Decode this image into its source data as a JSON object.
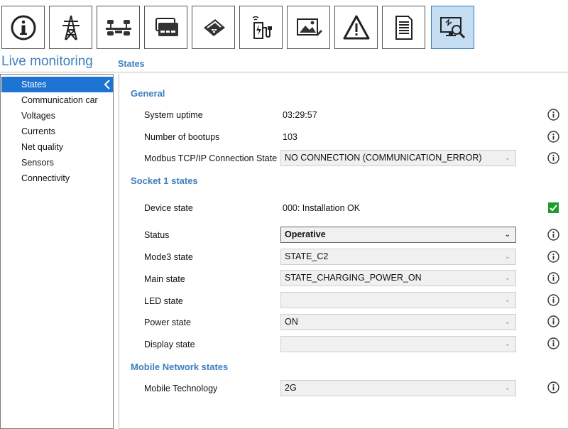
{
  "toolbar": {
    "buttons": [
      {
        "name": "info-icon",
        "active": false
      },
      {
        "name": "power-tower-icon",
        "active": false
      },
      {
        "name": "connection-icon",
        "active": false
      },
      {
        "name": "payment-card-icon",
        "active": false
      },
      {
        "name": "card-reader-icon",
        "active": false
      },
      {
        "name": "charging-station-icon",
        "active": false
      },
      {
        "name": "image-edit-icon",
        "active": false
      },
      {
        "name": "warning-icon",
        "active": false
      },
      {
        "name": "document-icon",
        "active": false
      },
      {
        "name": "monitor-search-icon",
        "active": true
      }
    ]
  },
  "sidebar": {
    "title": "Live monitoring",
    "items": [
      {
        "label": "States",
        "selected": true
      },
      {
        "label": "Communication car",
        "selected": false
      },
      {
        "label": "Voltages",
        "selected": false
      },
      {
        "label": "Currents",
        "selected": false
      },
      {
        "label": "Net quality",
        "selected": false
      },
      {
        "label": "Sensors",
        "selected": false
      },
      {
        "label": "Connectivity",
        "selected": false
      }
    ]
  },
  "main": {
    "title": "States",
    "sections": {
      "general": "General",
      "socket": "Socket 1 states",
      "mobile": "Mobile Network states"
    },
    "rows": {
      "system_uptime": {
        "label": "System uptime",
        "value": "03:29:57"
      },
      "bootups": {
        "label": "Number of bootups",
        "value": "103"
      },
      "modbus": {
        "label": "Modbus TCP/IP Connection State",
        "value": "NO CONNECTION (COMMUNICATION_ERROR)"
      },
      "device_state": {
        "label": "Device state",
        "value": "000: Installation OK"
      },
      "status": {
        "label": "Status",
        "value": "Operative"
      },
      "mode3": {
        "label": "Mode3 state",
        "value": "STATE_C2"
      },
      "main_state": {
        "label": "Main state",
        "value": "STATE_CHARGING_POWER_ON"
      },
      "led": {
        "label": "LED state",
        "value": ""
      },
      "power": {
        "label": "Power state",
        "value": "ON"
      },
      "display": {
        "label": "Display state",
        "value": ""
      },
      "mobile_tech": {
        "label": "Mobile Technology",
        "value": "2G"
      }
    }
  },
  "colors": {
    "accent": "#3f7fbd",
    "selected_bg": "#1e74d2",
    "ok_green": "#1e9b2b",
    "active_toolbar": "#c5ddf0"
  }
}
